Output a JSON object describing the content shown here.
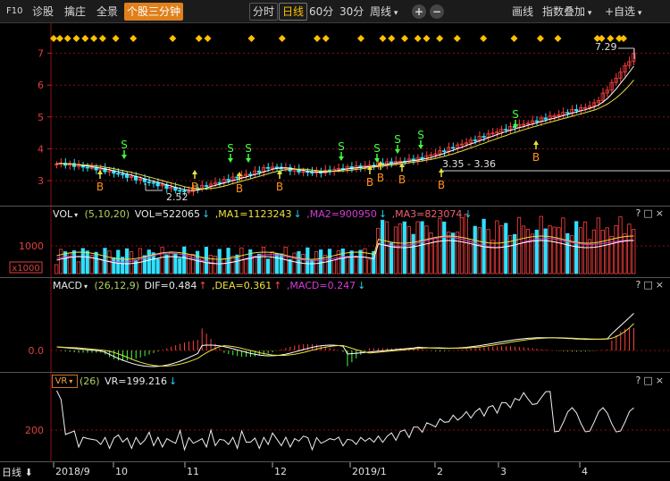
{
  "toolbar": {
    "f10": "F10",
    "diagnose": "诊股",
    "weight": "擒庄",
    "panorama": "全景",
    "three_min": "个股三分钟",
    "fenshi": "分时",
    "rixian": "日线",
    "m60": "60分",
    "m30": "30分",
    "zhouxian": "周线",
    "zoom_in": "+",
    "zoom_out": "−",
    "draw_line": "画线",
    "index_overlay": "指数叠加",
    "add_watchlist": "+自选"
  },
  "main_chart": {
    "y_ticks": [
      "7",
      "6",
      "5",
      "4",
      "3"
    ],
    "high_label": "7.29",
    "low_label": "2.52",
    "range_label": "3.35 - 3.36",
    "buy_mark": "B",
    "sell_mark": "S"
  },
  "vol": {
    "name": "VOL",
    "params": "(5,10,20)",
    "vol": "VOL=522065",
    "ma1": ",MA1=1123243",
    "ma2": ",MA2=900950",
    "ma3": ",MA3=823074",
    "tick": "1000",
    "unit": "x1000"
  },
  "macd": {
    "name": "MACD",
    "params": "(26,12,9)",
    "dif": "DIF=0.484",
    "dea": ",DEA=0.361",
    "macd_val": ",MACD=0.247",
    "tick": "0.0"
  },
  "vr": {
    "name": "VR",
    "params": "(26)",
    "value": "VR=199.216",
    "tick": "200"
  },
  "panel_controls": "?□×",
  "x_axis": {
    "labels": [
      "2018/9",
      "10",
      "11",
      "12",
      "2019/1",
      "2",
      "3",
      "4"
    ],
    "period": "日线"
  },
  "colors": {
    "up": "#ff4040",
    "down": "#30e0ff",
    "ma_white": "#ffffff",
    "ma_yellow": "#e8e040",
    "ma_purple": "#d040d0",
    "grid": "#8a1010",
    "signal_diamond": "#ffc000",
    "buy": "#ff9020",
    "sell": "#40ff40"
  }
}
